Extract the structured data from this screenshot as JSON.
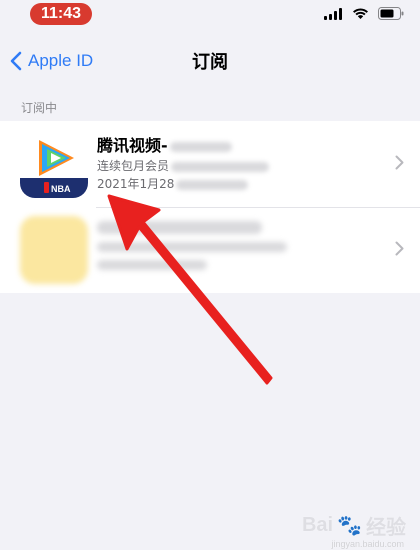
{
  "status_bar": {
    "time": "11:43"
  },
  "nav": {
    "back_label": "Apple ID",
    "title": "订阅"
  },
  "section": {
    "header": "订阅中"
  },
  "subscriptions": [
    {
      "title": "腾讯视频-",
      "line1": "连续包月会员",
      "line2": "2021年1月28",
      "icon": "tencent-video-nba-icon"
    },
    {
      "icon": "blurred-app-icon"
    }
  ],
  "watermark": {
    "text": "Bai",
    "text2": "经验",
    "sub": "jingyan.baidu.com"
  },
  "colors": {
    "accent": "#2f7bf6",
    "annotation": "#e8211f",
    "time_pill": "#d83a2f"
  }
}
